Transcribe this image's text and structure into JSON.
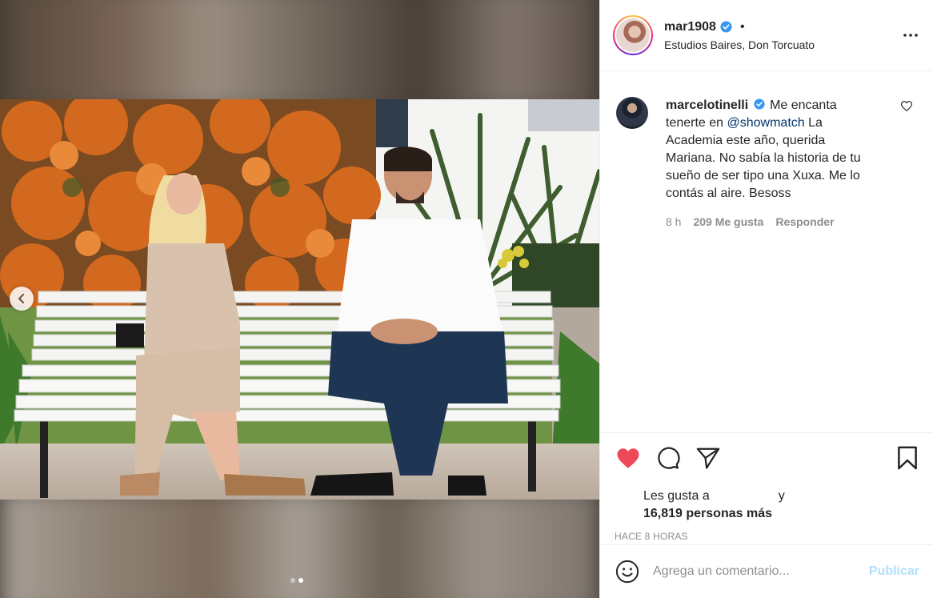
{
  "post": {
    "author": {
      "username": "mar1908",
      "verified": true,
      "separator": "•",
      "location": "Estudios Baires, Don Torcuato"
    },
    "carousel": {
      "slide_count": 2,
      "active_index": 1
    },
    "comment": {
      "username": "marcelotinelli",
      "verified": true,
      "text_before": "Me encanta tenerte en ",
      "mention": "@showmatch",
      "text_after": " La Academia este año, querida Mariana. No sabía la historia de tu sueño de ser tipo una Xuxa. Me lo contás al aire. Besoss",
      "time": "8 h",
      "likes": "209 Me gusta",
      "reply_label": "Responder"
    },
    "actions": {
      "liked": true,
      "like_color": "#ed4956",
      "liked_by_prefix": "Les gusta a",
      "liked_by_and": "y",
      "likes_count": "16,819 personas más",
      "time_ago": "HACE 8 HORAS"
    },
    "add_comment": {
      "placeholder": "Agrega un comentario...",
      "post_label": "Publicar"
    }
  }
}
